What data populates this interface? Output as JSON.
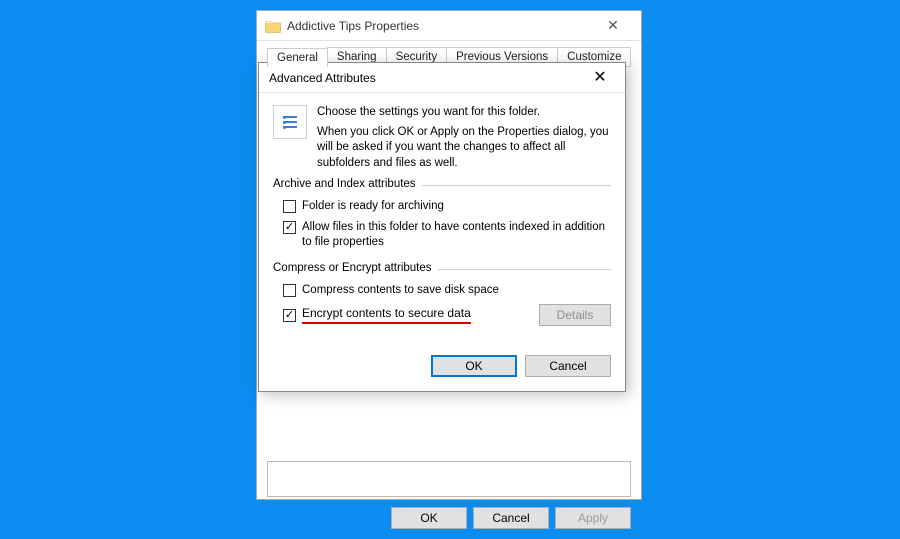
{
  "properties": {
    "title": "Addictive Tips Properties",
    "tabs": [
      "General",
      "Sharing",
      "Security",
      "Previous Versions",
      "Customize"
    ],
    "active_tab_index": 0,
    "buttons": {
      "ok": "OK",
      "cancel": "Cancel",
      "apply": "Apply"
    }
  },
  "advanced": {
    "title": "Advanced Attributes",
    "intro_line1": "Choose the settings you want for this folder.",
    "intro_line2": "When you click OK or Apply on the Properties dialog, you will be asked if you want the changes to affect all subfolders and files as well.",
    "group1_title": "Archive and Index attributes",
    "check_archive": {
      "label": "Folder is ready for archiving",
      "checked": false
    },
    "check_index": {
      "label": "Allow files in this folder to have contents indexed in addition to file properties",
      "checked": true
    },
    "group2_title": "Compress or Encrypt attributes",
    "check_compress": {
      "label": "Compress contents to save disk space",
      "checked": false
    },
    "check_encrypt": {
      "label": "Encrypt contents to secure data",
      "checked": true
    },
    "details_label": "Details",
    "buttons": {
      "ok": "OK",
      "cancel": "Cancel"
    }
  }
}
